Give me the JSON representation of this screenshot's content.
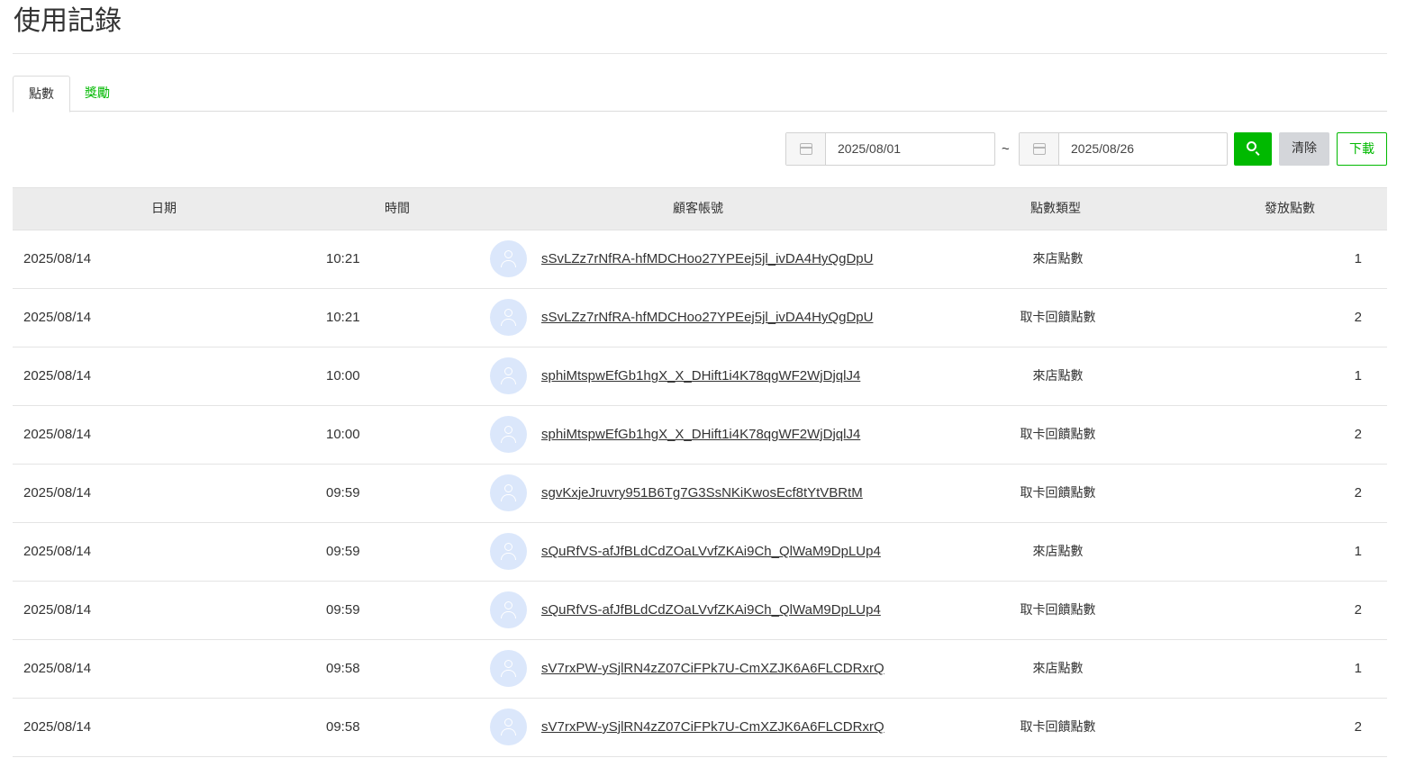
{
  "page": {
    "title": "使用記錄"
  },
  "tabs": [
    {
      "label": "點數",
      "active": true
    },
    {
      "label": "獎勵",
      "active": false
    }
  ],
  "filter": {
    "start_date": "2025/08/01",
    "end_date": "2025/08/26",
    "separator": "~",
    "search_icon": "search-icon",
    "clear_label": "清除",
    "download_label": "下載"
  },
  "colors": {
    "accent": "#00b900",
    "clear_bg": "#d4d6da",
    "header_bg": "#ececec",
    "avatar_bg": "#dbe7fb"
  },
  "table": {
    "headers": {
      "date": "日期",
      "time": "時間",
      "user": "顧客帳號",
      "type": "點數類型",
      "points": "發放點數"
    },
    "rows": [
      {
        "date": "2025/08/14",
        "time": "10:21",
        "user": "sSvLZz7rNfRA-hfMDCHoo27YPEej5jl_ivDA4HyQgDpU",
        "type": "來店點數",
        "points": "1"
      },
      {
        "date": "2025/08/14",
        "time": "10:21",
        "user": "sSvLZz7rNfRA-hfMDCHoo27YPEej5jl_ivDA4HyQgDpU",
        "type": "取卡回饋點數",
        "points": "2"
      },
      {
        "date": "2025/08/14",
        "time": "10:00",
        "user": "sphiMtspwEfGb1hgX_X_DHift1i4K78qgWF2WjDjqlJ4",
        "type": "來店點數",
        "points": "1"
      },
      {
        "date": "2025/08/14",
        "time": "10:00",
        "user": "sphiMtspwEfGb1hgX_X_DHift1i4K78qgWF2WjDjqlJ4",
        "type": "取卡回饋點數",
        "points": "2"
      },
      {
        "date": "2025/08/14",
        "time": "09:59",
        "user": "sgvKxjeJruvry951B6Tg7G3SsNKiKwosEcf8tYtVBRtM",
        "type": "取卡回饋點數",
        "points": "2"
      },
      {
        "date": "2025/08/14",
        "time": "09:59",
        "user": "sQuRfVS-afJfBLdCdZOaLVvfZKAi9Ch_QlWaM9DpLUp4",
        "type": "來店點數",
        "points": "1"
      },
      {
        "date": "2025/08/14",
        "time": "09:59",
        "user": "sQuRfVS-afJfBLdCdZOaLVvfZKAi9Ch_QlWaM9DpLUp4",
        "type": "取卡回饋點數",
        "points": "2"
      },
      {
        "date": "2025/08/14",
        "time": "09:58",
        "user": "sV7rxPW-ySjlRN4zZ07CiFPk7U-CmXZJK6A6FLCDRxrQ",
        "type": "來店點數",
        "points": "1"
      },
      {
        "date": "2025/08/14",
        "time": "09:58",
        "user": "sV7rxPW-ySjlRN4zZ07CiFPk7U-CmXZJK6A6FLCDRxrQ",
        "type": "取卡回饋點數",
        "points": "2"
      }
    ]
  }
}
